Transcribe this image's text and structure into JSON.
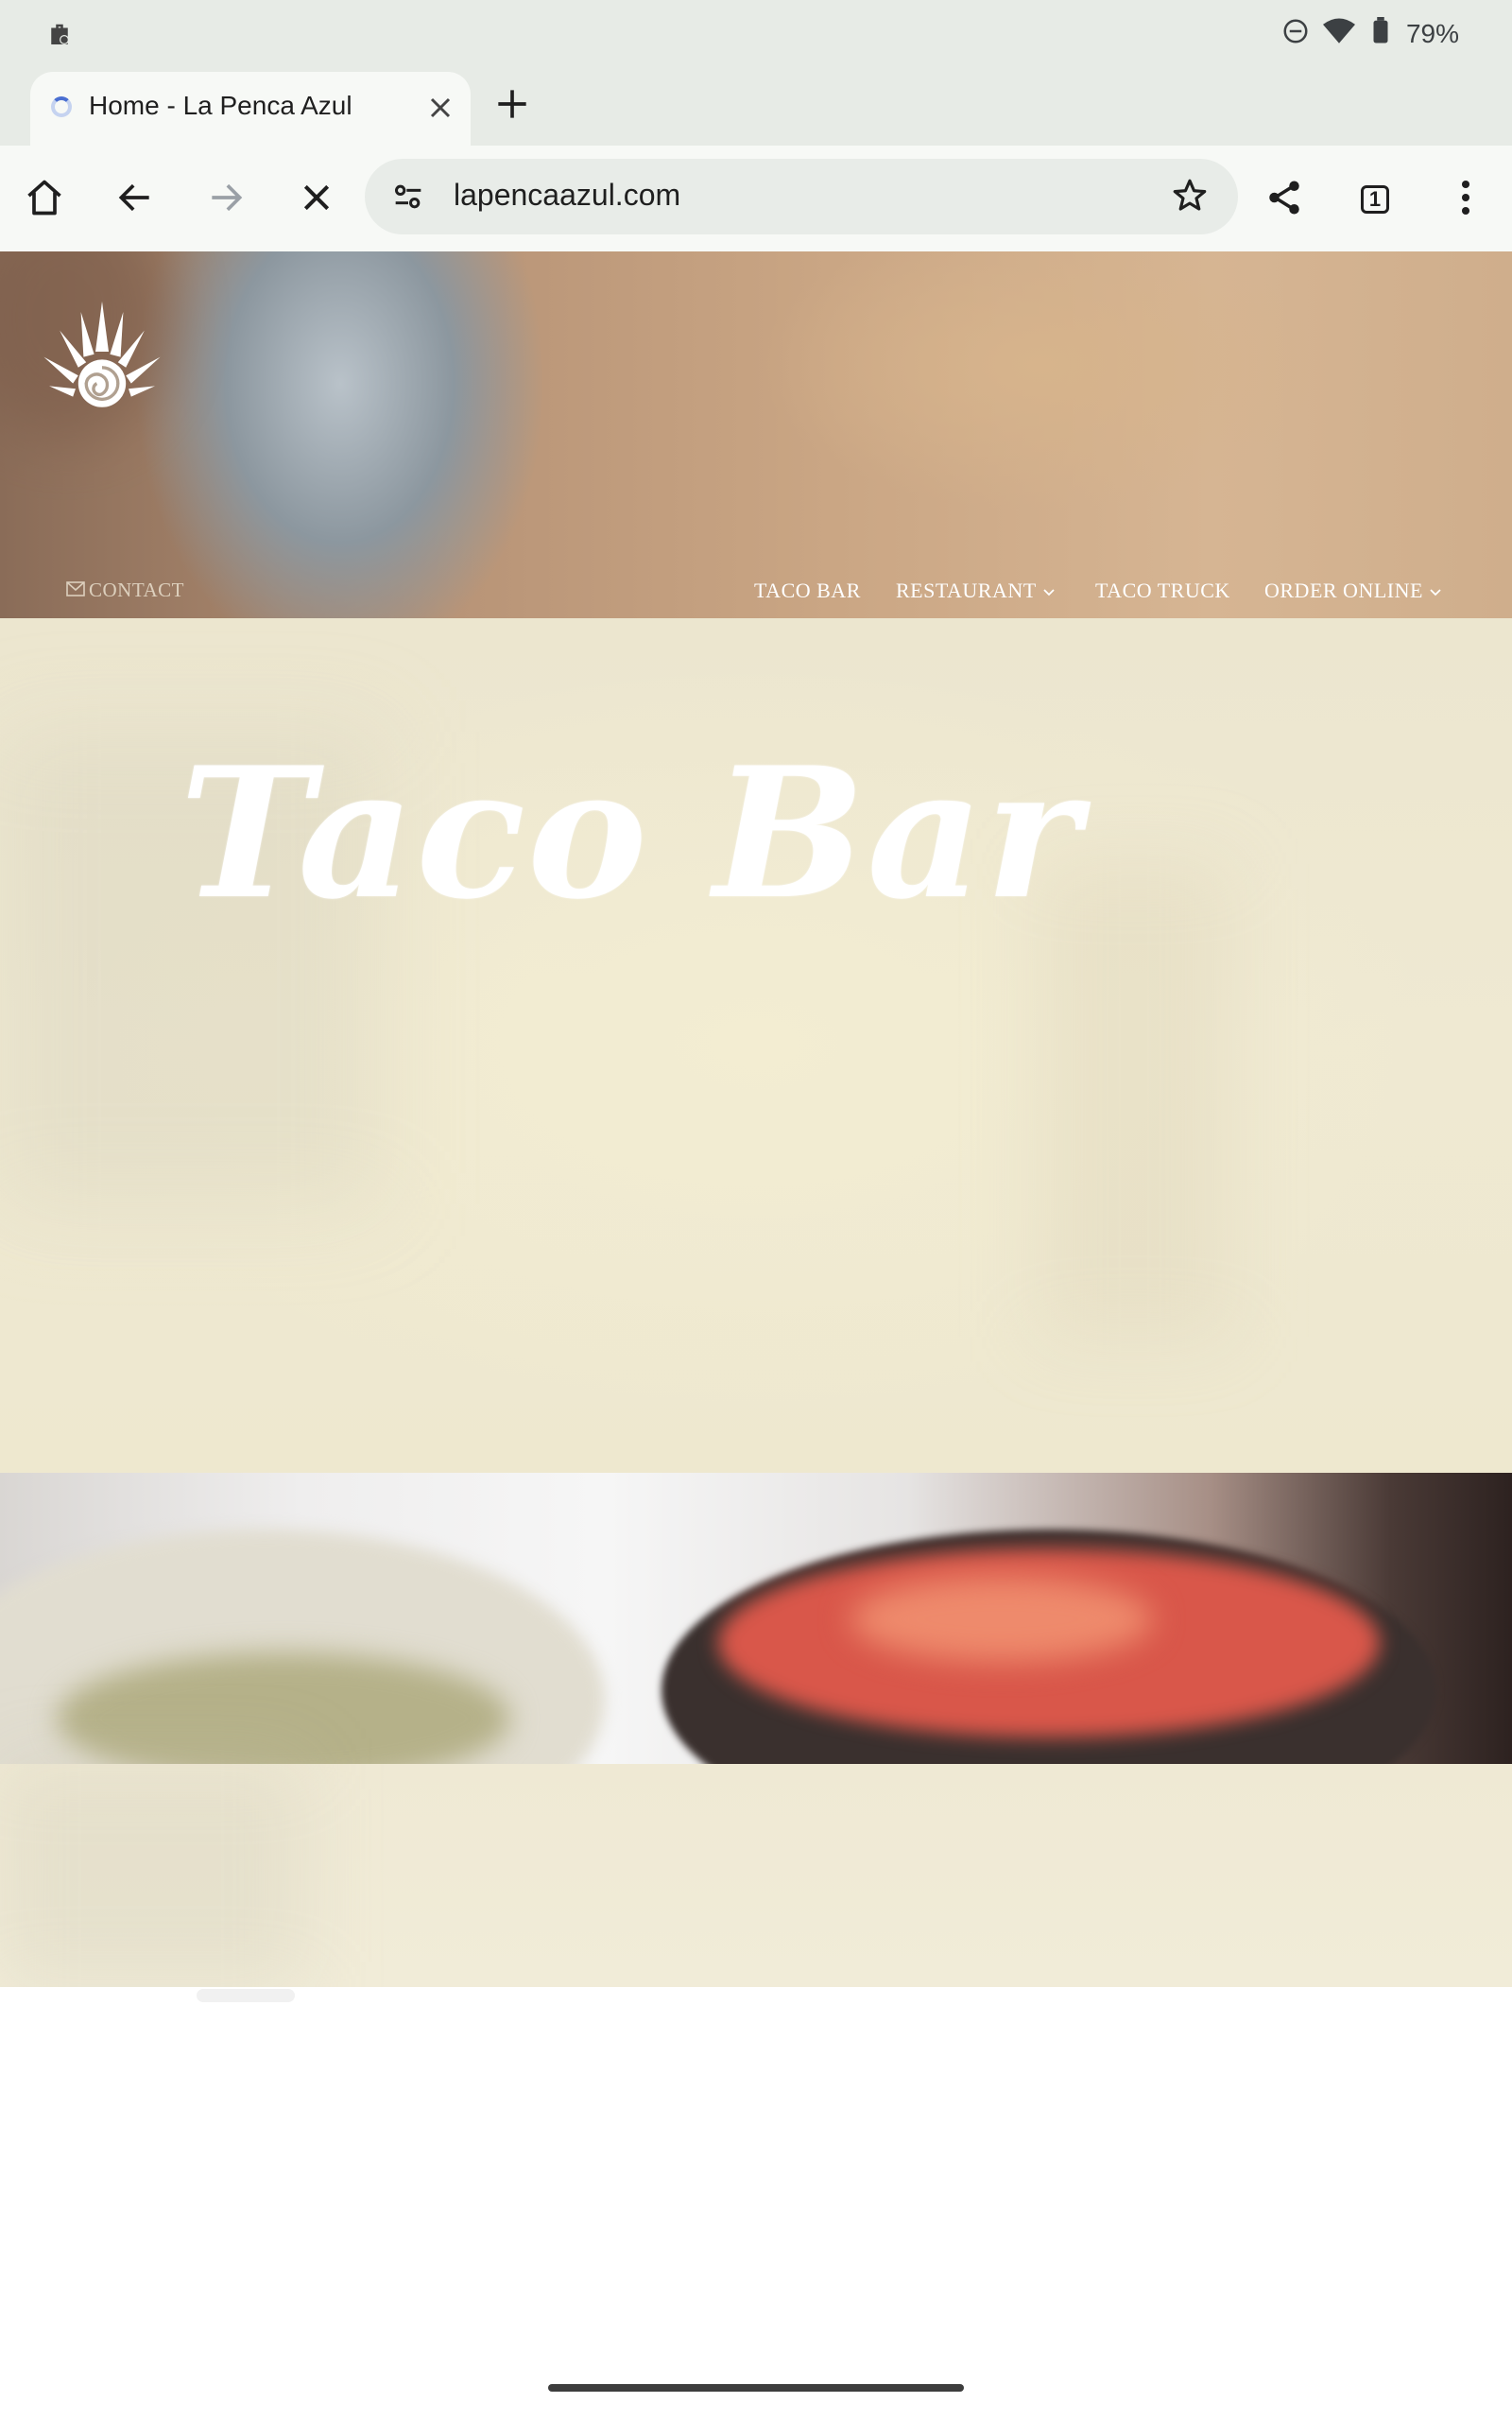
{
  "status_bar": {
    "battery": "79%",
    "icons": [
      "briefcase-icon",
      "do-not-disturb-icon",
      "wifi-icon",
      "battery-icon"
    ]
  },
  "browser": {
    "tab": {
      "title": "Home - La Penca Azul",
      "loading": true
    },
    "new_tab_label": "+",
    "url": "lapencaazul.com",
    "tab_count": "1",
    "toolbar_icons": [
      "home-icon",
      "back-icon",
      "forward-icon",
      "stop-icon",
      "site-settings-icon",
      "bookmark-star-icon",
      "share-icon",
      "tab-switcher-icon",
      "more-menu-icon"
    ]
  },
  "site": {
    "nav": {
      "contact": "CONTACT",
      "items": [
        "TACO BAR",
        "RESTAURANT",
        "TACO TRUCK",
        "ORDER ONLINE"
      ]
    },
    "banner_title": "Taco Bar"
  },
  "colors": {
    "browser_chrome": "#e7ebe6",
    "toolbar": "#f7f9f6",
    "banner_bg": "#efe9d2",
    "nav_text": "#ffffff"
  }
}
